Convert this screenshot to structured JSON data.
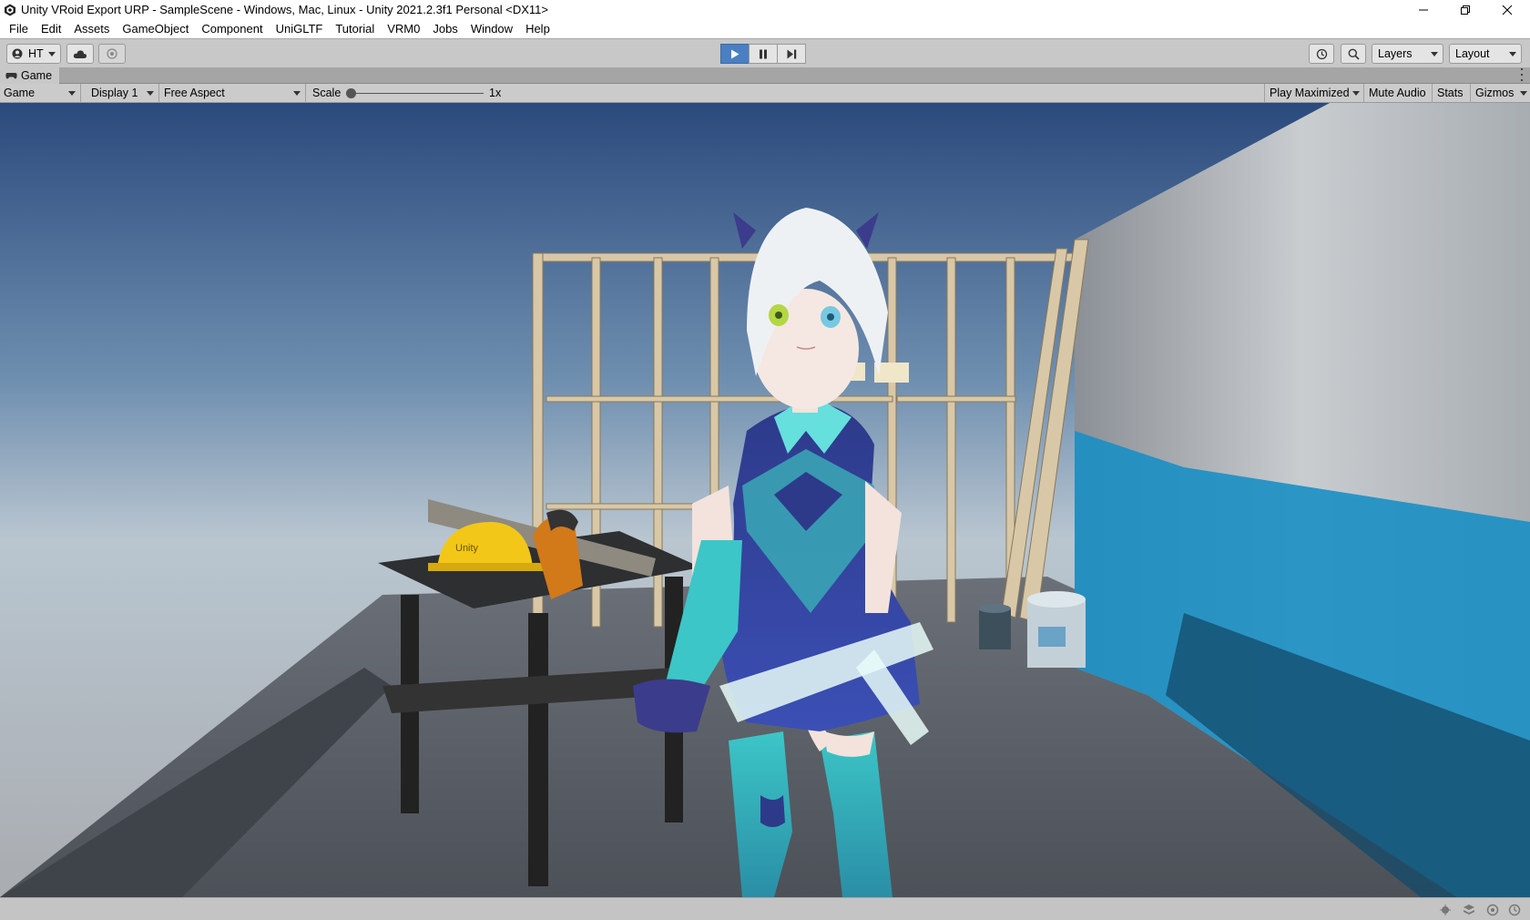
{
  "window": {
    "title": "Unity VRoid Export URP - SampleScene - Windows, Mac, Linux - Unity 2021.2.3f1 Personal <DX11>",
    "icons": [
      "unity-logo-icon",
      "minimize-icon",
      "restore-icon",
      "close-icon"
    ]
  },
  "menu": [
    "File",
    "Edit",
    "Assets",
    "GameObject",
    "Component",
    "UniGLTF",
    "Tutorial",
    "VRM0",
    "Jobs",
    "Window",
    "Help"
  ],
  "toolbar": {
    "account_label": "HT",
    "icons": [
      "account-icon",
      "cloud-icon",
      "collab-icon",
      "play-icon",
      "pause-icon",
      "step-icon",
      "history-icon",
      "search-icon"
    ],
    "play_active": true,
    "layers_label": "Layers",
    "layout_label": "Layout",
    "accent_color": "#4a7fc1"
  },
  "tab": {
    "label": "Game",
    "icon": "game-controller-icon"
  },
  "gamebar": {
    "view_label": "Game",
    "display_label": "Display 1",
    "aspect_label": "Free Aspect",
    "scale_label": "Scale",
    "scale_value": "1x",
    "play_maximized": "Play Maximized",
    "mute_audio": "Mute Audio",
    "stats": "Stats",
    "gizmos": "Gizmos"
  },
  "scene": {
    "description_colors": {
      "sky_top": "#2b4a7d",
      "sky_horizon": "#b9c6d0",
      "floor": "#5a6068",
      "wall_blue": "#1a8fc4"
    },
    "hardhat_text": "Unity"
  },
  "status": {
    "icons": [
      "debug-icon",
      "layers-icon",
      "cache-icon",
      "progress-icon"
    ]
  }
}
